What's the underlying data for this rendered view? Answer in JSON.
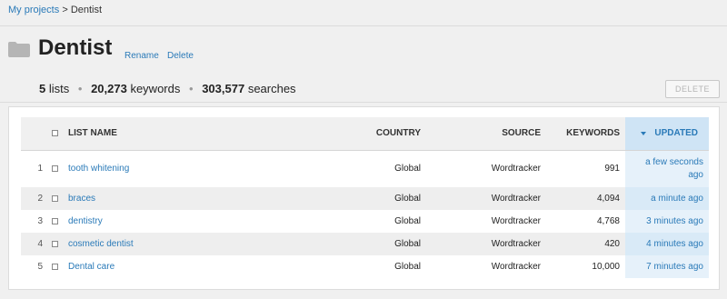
{
  "breadcrumb": {
    "parent": "My projects",
    "separator": ">",
    "current": "Dentist"
  },
  "header": {
    "title": "Dentist",
    "rename_label": "Rename",
    "delete_label": "Delete",
    "folder_icon": "folder-icon"
  },
  "summary": {
    "lists_count": "5",
    "lists_label": "lists",
    "keywords_count": "20,273",
    "keywords_label": "keywords",
    "searches_count": "303,577",
    "searches_label": "searches",
    "dot": "•"
  },
  "toolbar": {
    "delete_button": "DELETE"
  },
  "table": {
    "columns": {
      "name": "LIST NAME",
      "country": "COUNTRY",
      "source": "SOURCE",
      "keywords": "KEYWORDS",
      "updated": "UPDATED"
    },
    "rows": [
      {
        "num": "1",
        "name": "tooth whitening",
        "country": "Global",
        "source": "Wordtracker",
        "keywords": "991",
        "updated": "a few seconds ago"
      },
      {
        "num": "2",
        "name": "braces",
        "country": "Global",
        "source": "Wordtracker",
        "keywords": "4,094",
        "updated": "a minute ago"
      },
      {
        "num": "3",
        "name": "dentistry",
        "country": "Global",
        "source": "Wordtracker",
        "keywords": "4,768",
        "updated": "3 minutes ago"
      },
      {
        "num": "4",
        "name": "cosmetic dentist",
        "country": "Global",
        "source": "Wordtracker",
        "keywords": "420",
        "updated": "4 minutes ago"
      },
      {
        "num": "5",
        "name": "Dental care",
        "country": "Global",
        "source": "Wordtracker",
        "keywords": "10,000",
        "updated": "7 minutes ago"
      }
    ]
  },
  "colors": {
    "link": "#2a7ab8",
    "sorted_header": "#cfe4f5",
    "sorted_cell": "#e6f1fa"
  }
}
